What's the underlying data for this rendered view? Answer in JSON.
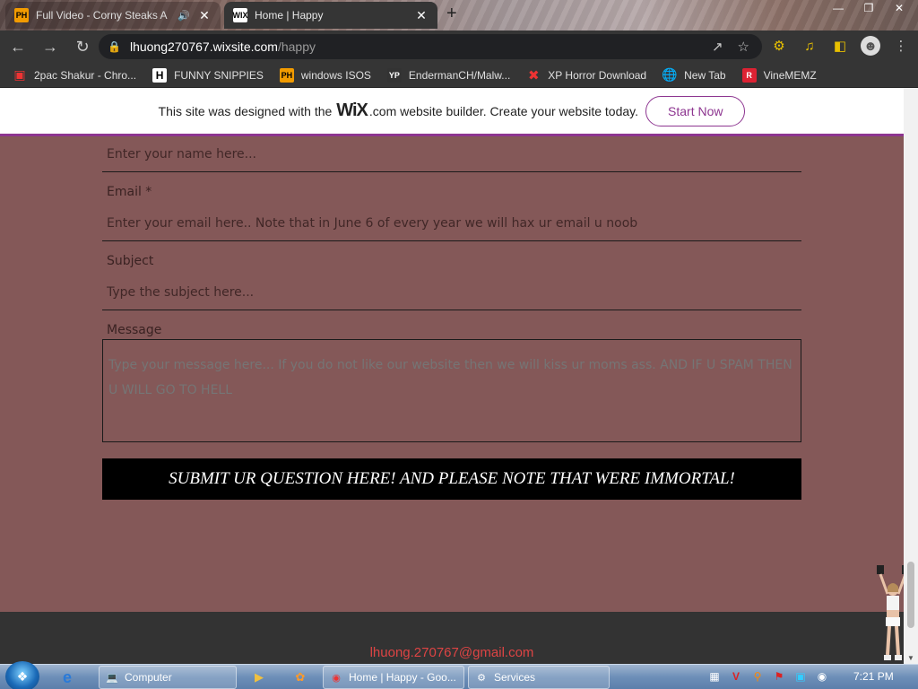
{
  "browser": {
    "tabs": [
      {
        "title": "Full Video - Corny Steaks A",
        "favicon": "PH",
        "active": false,
        "audio": true
      },
      {
        "title": "Home | Happy",
        "favicon": "WIX",
        "active": true,
        "audio": false
      }
    ],
    "url_host": "lhuong270767.wixsite.com",
    "url_path": "/happy",
    "bookmarks": [
      {
        "label": "2pac Shakur - Chro...",
        "icon": "T"
      },
      {
        "label": "FUNNY SNIPPIES",
        "icon": "H"
      },
      {
        "label": "windows ISOS",
        "icon": "PH"
      },
      {
        "label": "EndermanCH/Malw...",
        "icon": "YP"
      },
      {
        "label": "XP Horror Download",
        "icon": "X"
      },
      {
        "label": "New Tab",
        "icon": "globe"
      },
      {
        "label": "VineMEMZ",
        "icon": "R"
      }
    ]
  },
  "wix_banner": {
    "text_before": "This site was designed with the",
    "logo": "WiX",
    "text_after": ".com website builder. Create your website today.",
    "cta": "Start Now"
  },
  "form": {
    "name_placeholder": "Enter your name here...",
    "email_label": "Email *",
    "email_placeholder": "Enter your email here.. Note that in June 6 of every year we will hax ur email u noob",
    "subject_label": "Subject",
    "subject_placeholder": "Type the subject here...",
    "message_label": "Message",
    "message_placeholder": "Type your message here... If you do not like our website then we will kiss ur moms ass. AND IF U SPAM THEN U WILL GO TO HELL",
    "submit_label": "SUBMIT UR QUESTION HERE! AND PLEASE NOTE THAT WERE IMMORTAL!"
  },
  "footer": {
    "email": "lhuong.270767@gmail.com"
  },
  "taskbar": {
    "computer_label": "Computer",
    "chrome_label": "Home | Happy - Goo...",
    "services_label": "Services",
    "clock": "7:21 PM"
  },
  "colors": {
    "page_bg": "#845858",
    "wix_accent": "#8d3590",
    "footer_bg": "#333333",
    "footer_email": "#dd4444"
  }
}
